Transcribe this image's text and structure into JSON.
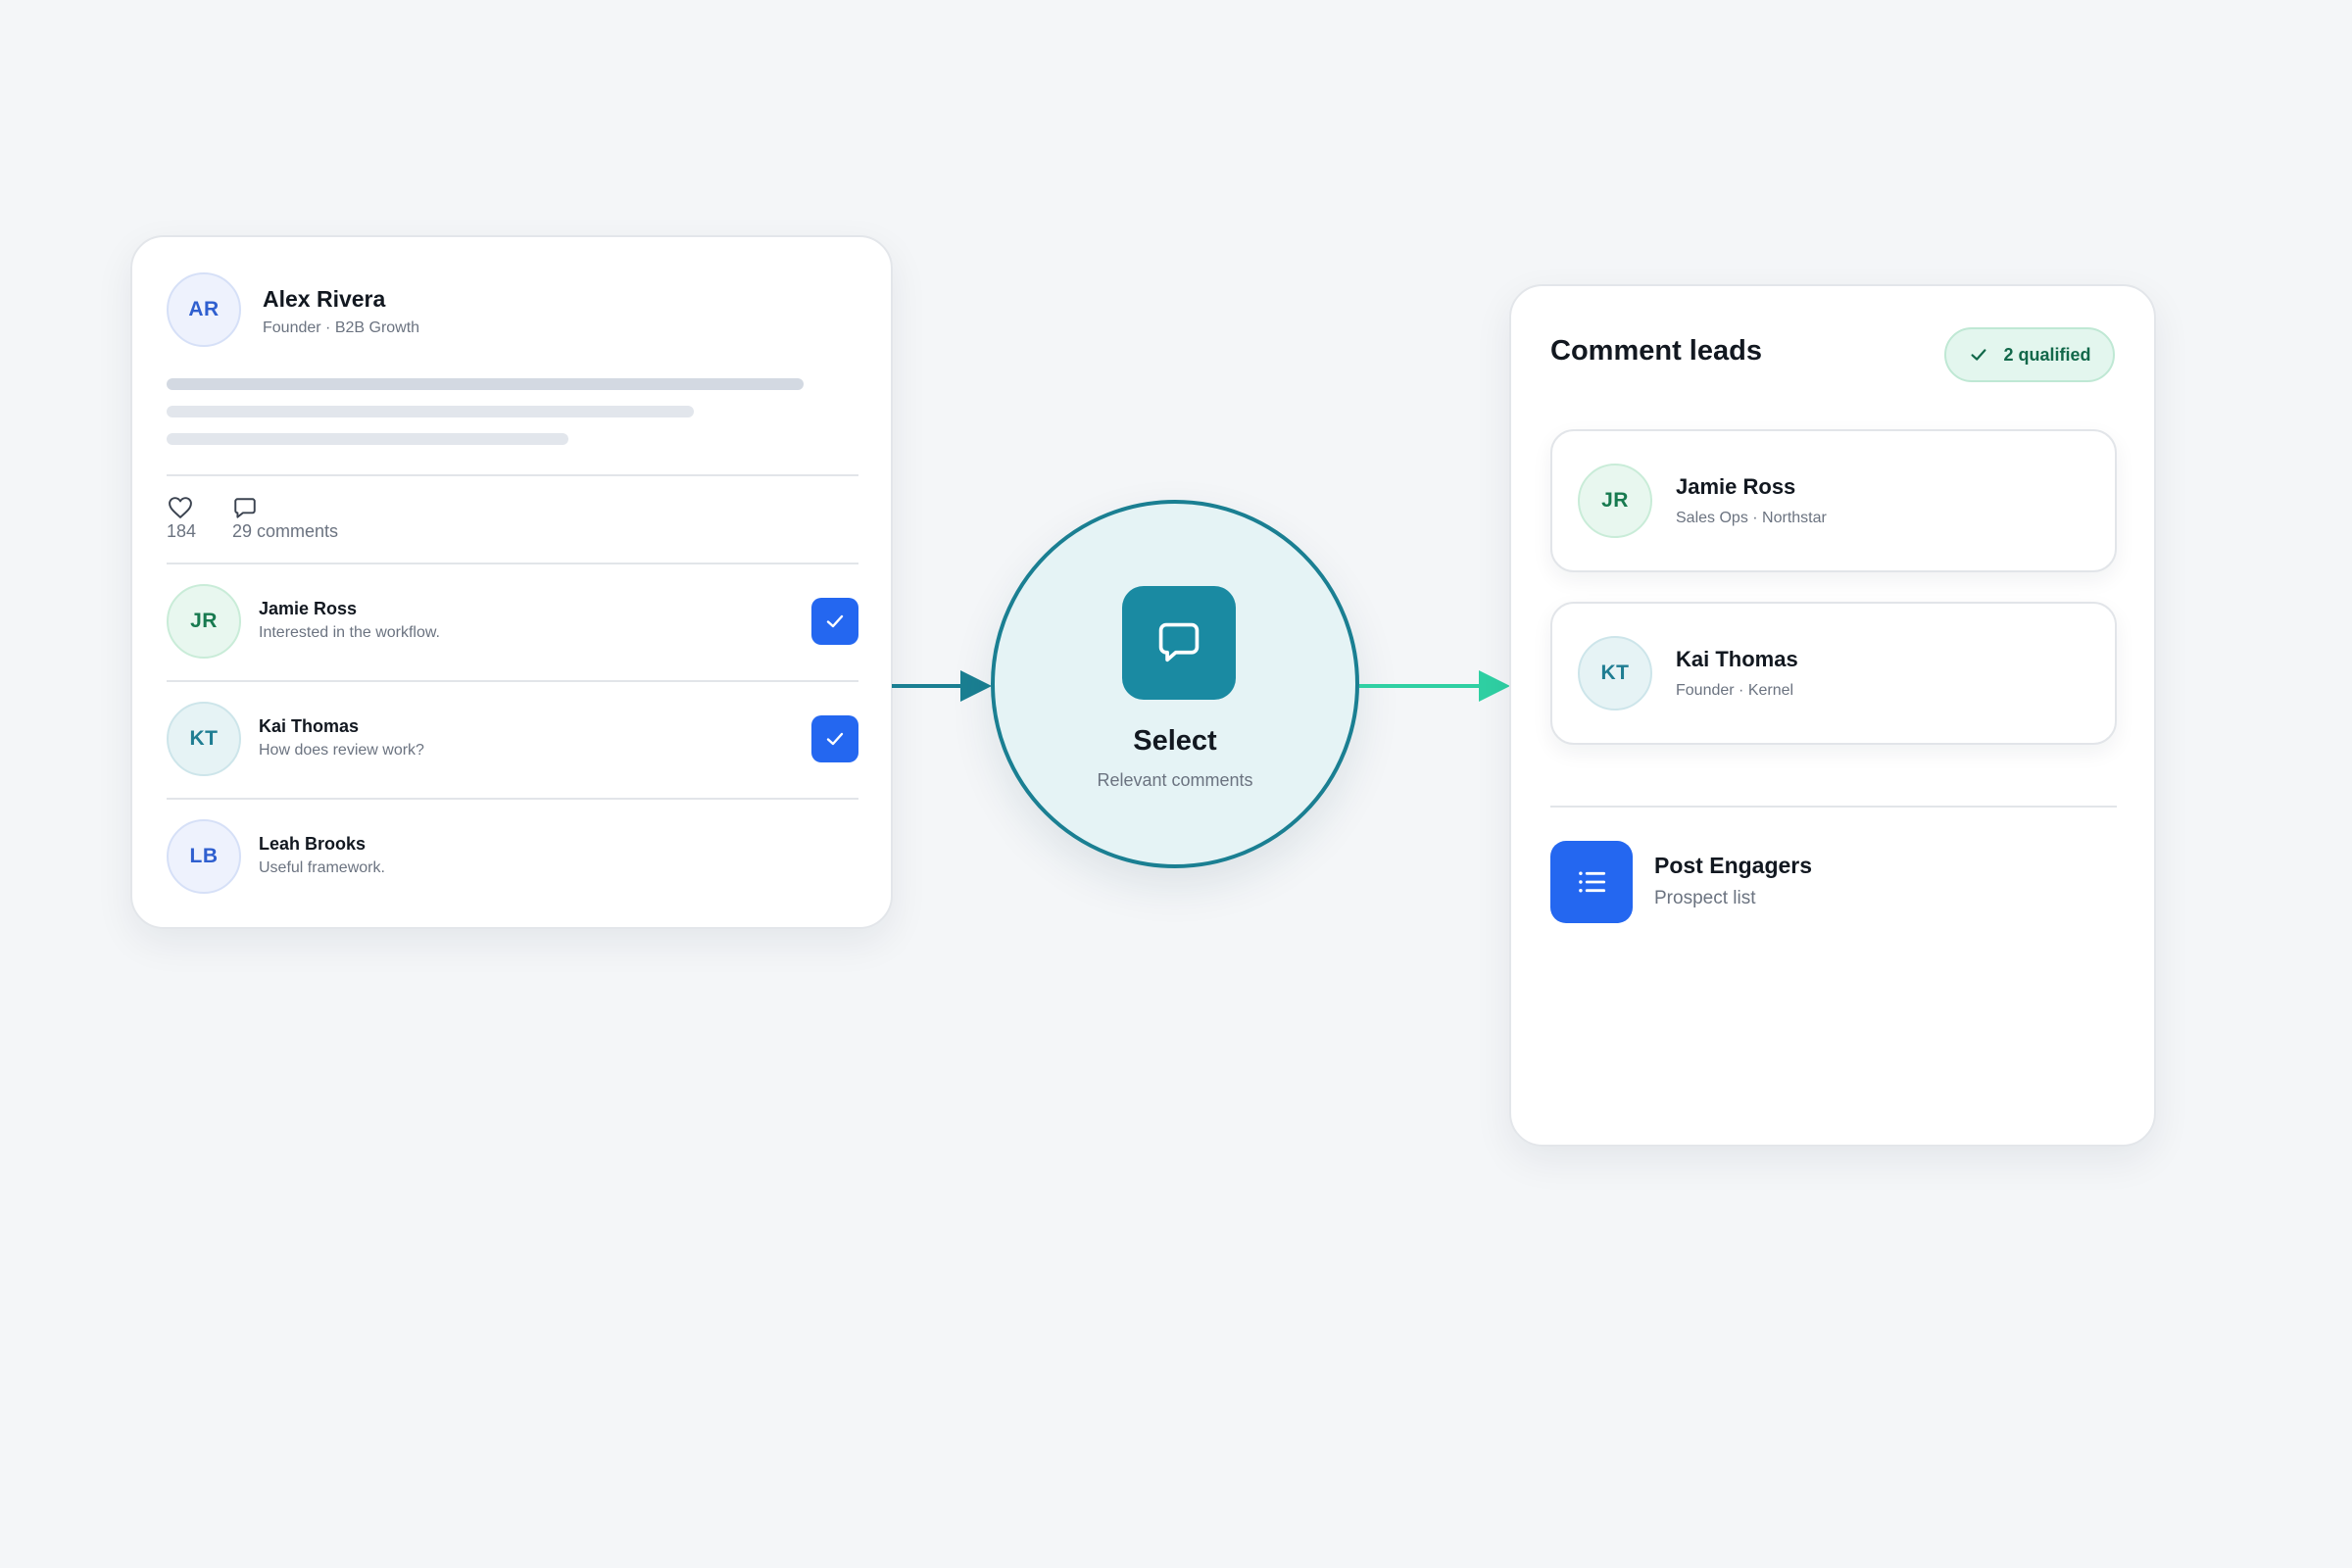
{
  "post": {
    "author": {
      "initials": "AR",
      "name": "Alex Rivera",
      "subtitle": "Founder · B2B Growth"
    },
    "likes_count": "184",
    "comments_count": "29 comments",
    "comments": [
      {
        "initials": "JR",
        "name": "Jamie Ross",
        "text": "Interested in the workflow.",
        "selected": true
      },
      {
        "initials": "KT",
        "name": "Kai Thomas",
        "text": "How does review work?",
        "selected": true
      },
      {
        "initials": "LB",
        "name": "Leah Brooks",
        "text": "Useful framework.",
        "selected": false
      }
    ]
  },
  "select_step": {
    "title": "Select",
    "subtitle": "Relevant comments",
    "icon": "chat-bubble-icon"
  },
  "leads": {
    "title": "Comment leads",
    "badge": "2 qualified",
    "items": [
      {
        "initials": "JR",
        "name": "Jamie Ross",
        "subtitle": "Sales Ops · Northstar"
      },
      {
        "initials": "KT",
        "name": "Kai Thomas",
        "subtitle": "Founder · Kernel"
      }
    ],
    "destination": {
      "name": "Post Engagers",
      "subtitle": "Prospect list",
      "icon": "list-icon"
    }
  },
  "colors": {
    "background": "#f4f6f8",
    "primary_blue": "#2467f0",
    "teal": "#1a7f92",
    "green_arrow": "#2fd0a3",
    "badge_green": "#12684a"
  }
}
